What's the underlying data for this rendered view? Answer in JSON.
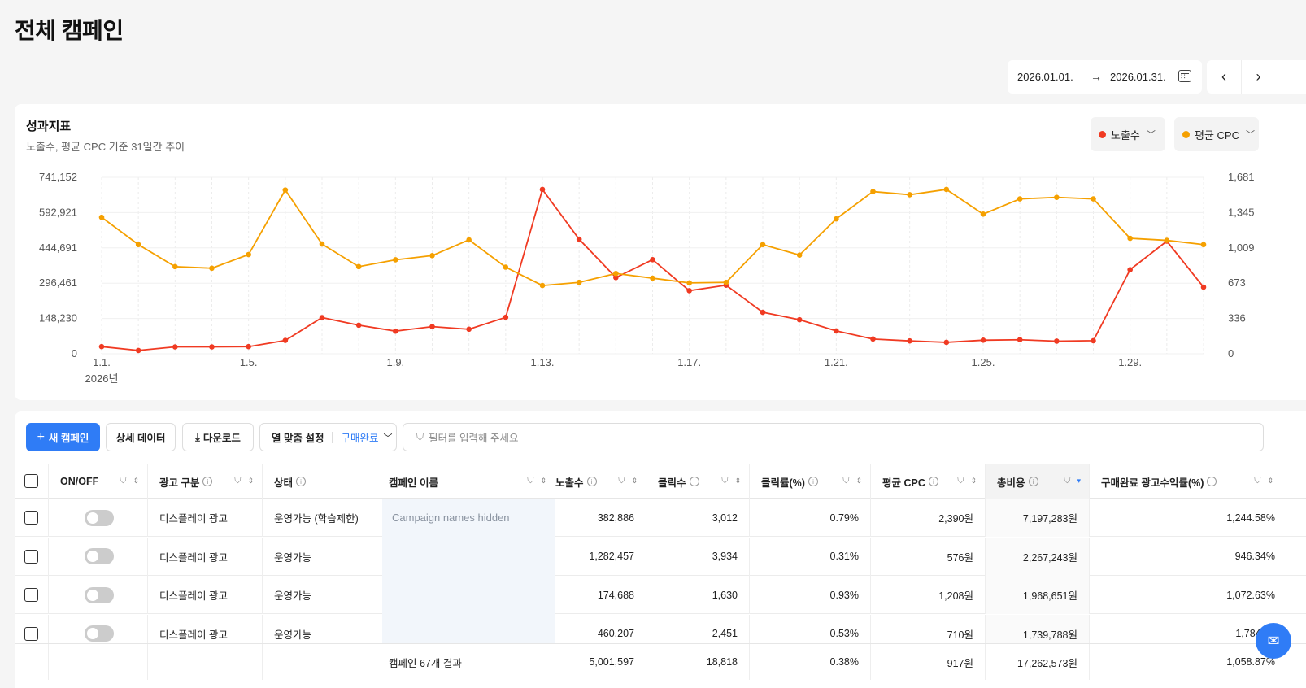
{
  "page": {
    "title": "전체 캠페인"
  },
  "date_range": {
    "start": "2026.01.01.",
    "arrow": "→",
    "end": "2026.01.31."
  },
  "nav": {
    "prev": "‹",
    "next": "›"
  },
  "chart_card": {
    "title": "성과지표",
    "subtitle": "노출수, 평균 CPC 기준 31일간 추이",
    "metric1": {
      "label": "노출수",
      "color": "#f03a22"
    },
    "metric2": {
      "label": "평균 CPC",
      "color": "#f5a000"
    }
  },
  "chart_data": {
    "type": "line",
    "x": [
      "1.1.",
      "1.2.",
      "1.3.",
      "1.4.",
      "1.5.",
      "1.6.",
      "1.7.",
      "1.8.",
      "1.9.",
      "1.10.",
      "1.11.",
      "1.12.",
      "1.13.",
      "1.14.",
      "1.15.",
      "1.16.",
      "1.17.",
      "1.18.",
      "1.19.",
      "1.20.",
      "1.21.",
      "1.22.",
      "1.23.",
      "1.24.",
      "1.25.",
      "1.26.",
      "1.27.",
      "1.28.",
      "1.29.",
      "1.30.",
      "1.31."
    ],
    "x_tick_labels": [
      "1.1.",
      "1.5.",
      "1.9.",
      "1.13.",
      "1.17.",
      "1.21.",
      "1.25.",
      "1.29."
    ],
    "x_year_label": "2026년",
    "y_left": {
      "ticks": [
        "741,152",
        "592,921",
        "444,691",
        "296,461",
        "148,230",
        "0"
      ],
      "range": [
        0,
        741152
      ]
    },
    "y_right": {
      "ticks": [
        "1,681",
        "1,345",
        "1,009",
        "673",
        "336",
        "0"
      ],
      "range": [
        0,
        1681
      ]
    },
    "series": [
      {
        "name": "노출수",
        "axis": "left",
        "color": "#f03a22",
        "values": [
          30000,
          14000,
          29000,
          29000,
          30000,
          56000,
          152000,
          120000,
          95000,
          114000,
          103000,
          153000,
          690000,
          481000,
          320000,
          395000,
          265000,
          288000,
          174000,
          143000,
          96000,
          62000,
          54000,
          48000,
          57000,
          59000,
          53000,
          55000,
          353000,
          473000,
          280000
        ]
      },
      {
        "name": "평균 CPC",
        "axis": "right",
        "color": "#f5a000",
        "values": [
          1300,
          1040,
          830,
          815,
          945,
          1560,
          1045,
          830,
          895,
          935,
          1085,
          825,
          650,
          680,
          765,
          720,
          675,
          680,
          1040,
          940,
          1285,
          1545,
          1515,
          1565,
          1330,
          1475,
          1490,
          1475,
          1100,
          1080,
          1040
        ]
      }
    ],
    "grid": true
  },
  "toolbar": {
    "new_campaign": "새 캠페인",
    "detail_data": "상세 데이터",
    "download": "다운로드",
    "column_preset": "열 맞춤 설정",
    "column_preset_value": "구매완료",
    "filter_placeholder": "필터를 입력해 주세요"
  },
  "table": {
    "headers": {
      "onoff": "ON/OFF",
      "ad_type": "광고 구분",
      "status": "상태",
      "campaign_name": "캠페인 이름",
      "impressions": "노출수",
      "clicks": "클릭수",
      "ctr": "클릭률(%)",
      "avg_cpc": "평균 CPC",
      "total_cost": "총비용",
      "roas": "구매완료 광고수익률(%)"
    },
    "hidden_notice": "Campaign names hidden",
    "rows": [
      {
        "ad_type": "디스플레이 광고",
        "status": "운영가능 (학습제한)",
        "impressions": "382,886",
        "clicks": "3,012",
        "ctr": "0.79%",
        "avg_cpc": "2,390원",
        "total_cost": "7,197,283원",
        "roas": "1,244.58%"
      },
      {
        "ad_type": "디스플레이 광고",
        "status": "운영가능",
        "impressions": "1,282,457",
        "clicks": "3,934",
        "ctr": "0.31%",
        "avg_cpc": "576원",
        "total_cost": "2,267,243원",
        "roas": "946.34%"
      },
      {
        "ad_type": "디스플레이 광고",
        "status": "운영가능",
        "impressions": "174,688",
        "clicks": "1,630",
        "ctr": "0.93%",
        "avg_cpc": "1,208원",
        "total_cost": "1,968,651원",
        "roas": "1,072.63%"
      },
      {
        "ad_type": "디스플레이 광고",
        "status": "운영가능",
        "impressions": "460,207",
        "clicks": "2,451",
        "ctr": "0.53%",
        "avg_cpc": "710원",
        "total_cost": "1,739,788원",
        "roas": "1,784.46"
      }
    ],
    "summary": {
      "label": "캠페인 67개 결과",
      "impressions": "5,001,597",
      "clicks": "18,818",
      "ctr": "0.38%",
      "avg_cpc": "917원",
      "total_cost": "17,262,573원",
      "roas": "1,058.87%"
    }
  },
  "icons": {
    "filter": "filter-icon",
    "sort": "sort-icon",
    "info": "info-icon",
    "calendar": "calendar-icon",
    "chat": "chat-icon"
  }
}
